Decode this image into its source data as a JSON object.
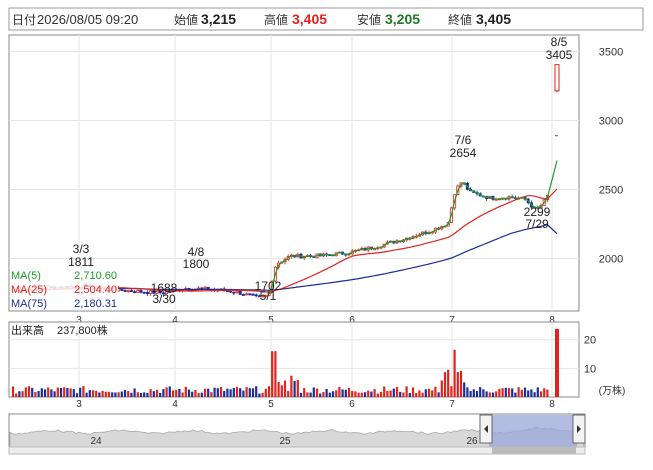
{
  "header": {
    "date_label": "日付",
    "date_value": "2026/08/05 09:20",
    "open_label": "始値",
    "open_value": "3,215",
    "high_label": "高値",
    "high_value": "3,405",
    "low_label": "安値",
    "low_value": "3,205",
    "close_label": "終値",
    "close_value": "3,405"
  },
  "colors": {
    "up": "#e0231c",
    "down": "#1c2d99",
    "ma5": "#1f9a2a",
    "ma25": "#e0231c",
    "ma75": "#1c2d99",
    "high_text": "#e0231c",
    "low_text": "#1f7a25",
    "nav_fill": "#9aa6d8"
  },
  "chart_data": [
    {
      "type": "candlestick",
      "title": "",
      "x_tick_labels": [
        "3",
        "4",
        "5",
        "6",
        "7",
        "8"
      ],
      "y_tick_labels": [
        "2000",
        "2500",
        "3000",
        "3500"
      ],
      "ylim": [
        1620,
        3620
      ],
      "grid": true,
      "series": [
        {
          "name": "MA(5)",
          "last_value": "2,710.60"
        },
        {
          "name": "MA(25)",
          "last_value": "2,504.40"
        },
        {
          "name": "MA(75)",
          "last_value": "2,180.31"
        }
      ],
      "annotations": [
        {
          "date": "3/3",
          "value": "1811"
        },
        {
          "date": "3/30",
          "value": "1688"
        },
        {
          "date": "4/8",
          "value": "1800"
        },
        {
          "date": "5/1",
          "value": "1702"
        },
        {
          "date": "7/6",
          "value": "2654"
        },
        {
          "date": "7/29",
          "value": "2299"
        },
        {
          "date": "8/5",
          "value": "3405"
        }
      ],
      "last_candle": {
        "open": 3215,
        "high": 3405,
        "low": 3205,
        "close": 3405
      }
    },
    {
      "type": "bar",
      "title": "出来高",
      "last_value_text": "237,800株",
      "y_tick_labels": [
        "10",
        "20"
      ],
      "unit": "(万株)",
      "x_tick_labels": [
        "3",
        "4",
        "5",
        "6",
        "7",
        "8"
      ],
      "last_value": 23.78
    },
    {
      "type": "area",
      "x_tick_labels": [
        "24",
        "25",
        "26"
      ]
    }
  ]
}
